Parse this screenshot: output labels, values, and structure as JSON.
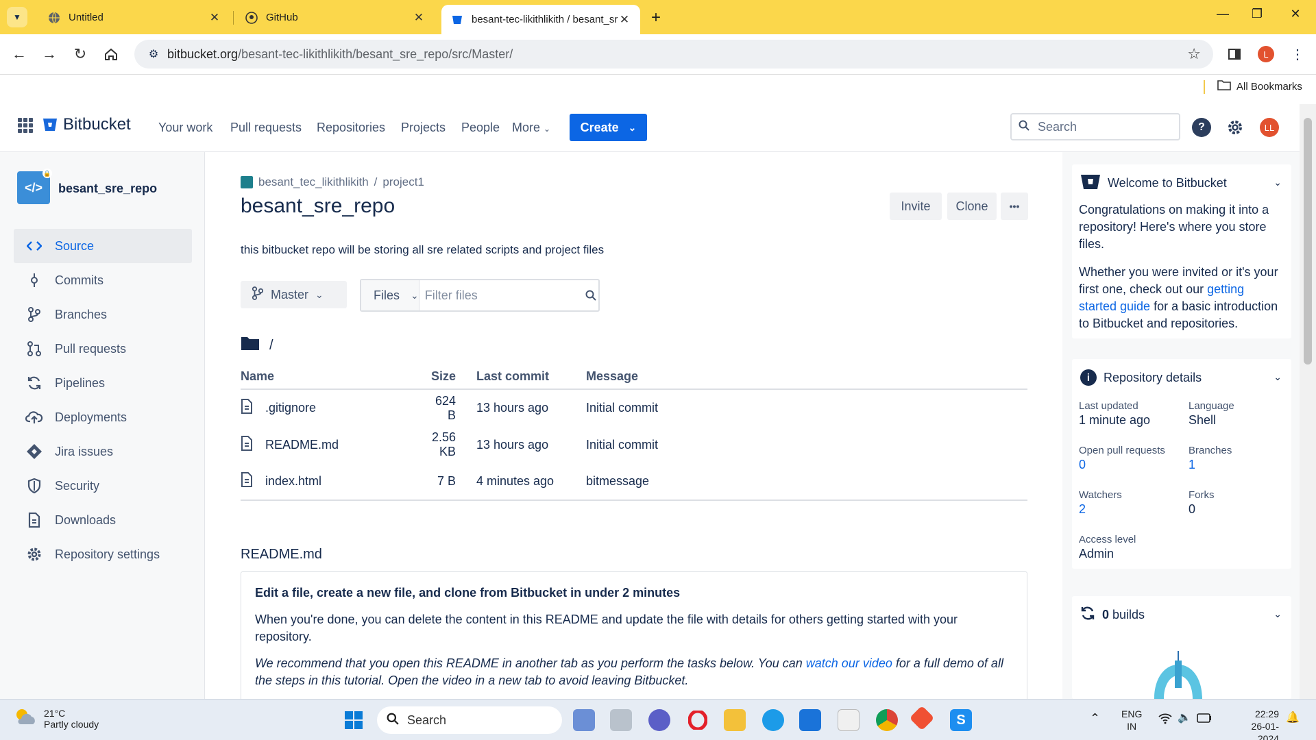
{
  "browser": {
    "tabs": [
      {
        "title": "Untitled",
        "icon": "globe-icon"
      },
      {
        "title": "GitHub",
        "icon": "github-icon"
      },
      {
        "title": "besant-tec-likithlikith / besant_sre_repo",
        "icon": "bitbucket-icon",
        "active": true
      }
    ],
    "url_domain": "bitbucket.org",
    "url_path": "/besant-tec-likithlikith/besant_sre_repo/src/Master/",
    "profile_initial": "L",
    "bookmarks_label": "All Bookmarks"
  },
  "bb_nav": {
    "logo": "Bitbucket",
    "items": [
      "Your work",
      "Pull requests",
      "Repositories",
      "Projects",
      "People",
      "More"
    ],
    "create_label": "Create",
    "search_placeholder": "Search",
    "avatar_initials": "LL",
    "brand_color": "#0c66e4"
  },
  "sidebar": {
    "repo_name": "besant_sre_repo",
    "items": [
      {
        "label": "Source",
        "icon": "code-icon",
        "active": true
      },
      {
        "label": "Commits",
        "icon": "commit-icon"
      },
      {
        "label": "Branches",
        "icon": "branch-icon"
      },
      {
        "label": "Pull requests",
        "icon": "pull-request-icon"
      },
      {
        "label": "Pipelines",
        "icon": "pipelines-icon"
      },
      {
        "label": "Deployments",
        "icon": "cloud-upload-icon"
      },
      {
        "label": "Jira issues",
        "icon": "jira-icon"
      },
      {
        "label": "Security",
        "icon": "shield-icon"
      },
      {
        "label": "Downloads",
        "icon": "document-icon"
      },
      {
        "label": "Repository settings",
        "icon": "gear-icon"
      }
    ]
  },
  "main": {
    "workspace": "besant_tec_likithlikith",
    "project": "project1",
    "title": "besant_sre_repo",
    "invite_label": "Invite",
    "clone_label": "Clone",
    "more_label": "•••",
    "description": "this bitbucket repo will be storing all sre related scripts and project files",
    "branch": "Master",
    "files_label": "Files",
    "filter_placeholder": "Filter files",
    "path": "/",
    "columns": {
      "name": "Name",
      "size": "Size",
      "last_commit": "Last commit",
      "message": "Message"
    },
    "files": [
      {
        "name": ".gitignore",
        "size": "624 B",
        "last_commit": "13 hours ago",
        "message": "Initial commit"
      },
      {
        "name": "README.md",
        "size": "2.56 KB",
        "last_commit": "13 hours ago",
        "message": "Initial commit"
      },
      {
        "name": "index.html",
        "size": "7 B",
        "last_commit": "4 minutes ago",
        "message": "bitmessage"
      }
    ],
    "readme": {
      "filename": "README.md",
      "heading": "Edit a file, create a new file, and clone from Bitbucket in under 2 minutes",
      "para1": "When you're done, you can delete the content in this README and update the file with details for others getting started with your repository.",
      "para2_a": "We recommend that you open this README in another tab as you perform the tasks below. You can ",
      "para2_link": "watch our video",
      "para2_b": " for a full demo of all the steps in this tutorial. Open the video in a new tab to avoid leaving Bitbucket."
    }
  },
  "right_panel": {
    "welcome": {
      "title": "Welcome to Bitbucket",
      "p1": "Congratulations on making it into a repository! Here's where you store files.",
      "p2_a": "Whether you were invited or it's your first one, check out our ",
      "p2_link": "getting started guide",
      "p2_b": " for a basic introduction to Bitbucket and repositories."
    },
    "details": {
      "title": "Repository details",
      "last_updated_label": "Last updated",
      "last_updated": "1 minute ago",
      "language_label": "Language",
      "language": "Shell",
      "open_prs_label": "Open pull requests",
      "open_prs": "0",
      "branches_label": "Branches",
      "branches": "1",
      "watchers_label": "Watchers",
      "watchers": "2",
      "forks_label": "Forks",
      "forks": "0",
      "access_label": "Access level",
      "access": "Admin"
    },
    "builds": {
      "count": "0",
      "label": "builds"
    }
  },
  "taskbar": {
    "temp": "21°C",
    "weather": "Partly cloudy",
    "search_label": "Search",
    "lang1": "ENG",
    "lang2": "IN",
    "time": "22:29",
    "date": "26-01-2024"
  }
}
